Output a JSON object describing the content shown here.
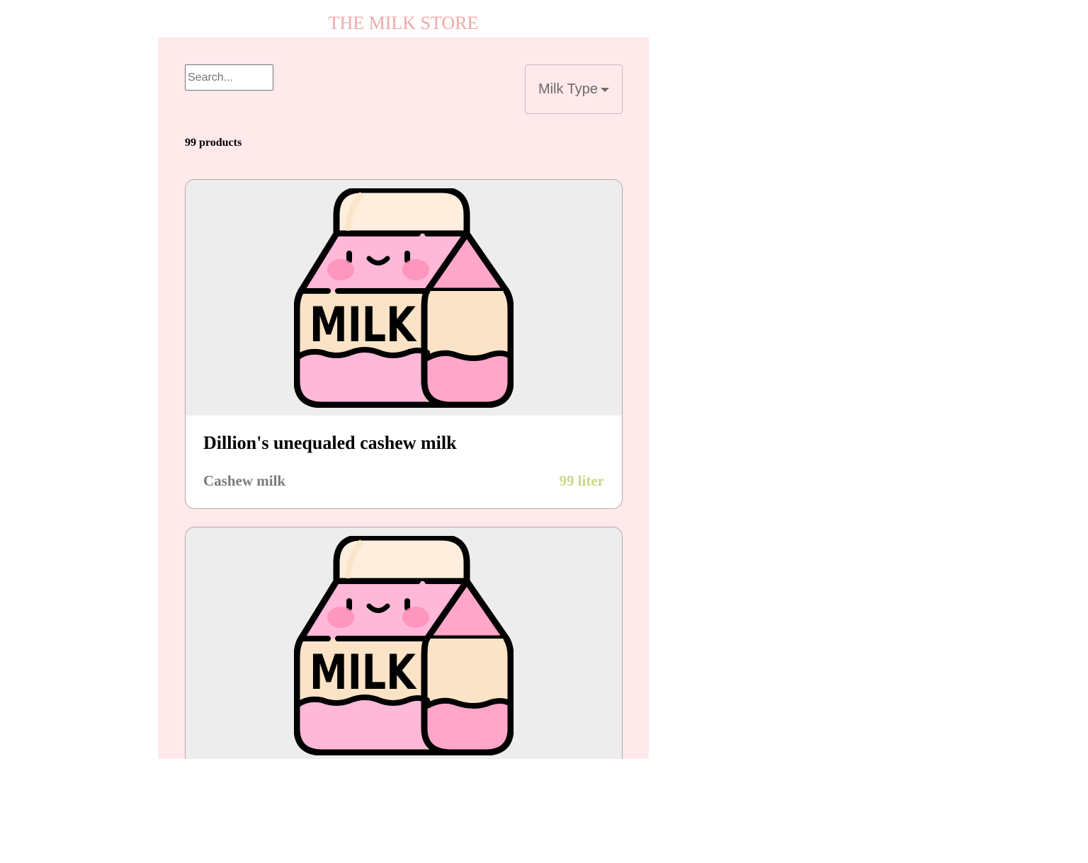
{
  "header": {
    "title": "THE MILK STORE"
  },
  "toolbar": {
    "search_placeholder": "Search...",
    "search_value": "",
    "filter_label": "Milk Type"
  },
  "summary": {
    "count_text": "99 products"
  },
  "products": [
    {
      "name": "Dillion's unequaled cashew milk",
      "type": "Cashew milk",
      "volume": "99 liter",
      "image": {
        "icon": "milk-carton-icon",
        "label": "MILK"
      }
    },
    {
      "image": {
        "icon": "milk-carton-icon",
        "label": "MILK"
      }
    }
  ],
  "colors": {
    "title": "#f4a6a6",
    "panel_bg": "#ffe9ea",
    "card_image_bg": "#ededed",
    "type_text": "#7a7a7a",
    "volume_text": "#c6d98a",
    "carton_pink": "#ffb8d8",
    "carton_pink_dark": "#ffa6c9",
    "carton_cream": "#fae3c6",
    "carton_cap": "#fdeedd",
    "cheek": "#ff8fb8"
  }
}
